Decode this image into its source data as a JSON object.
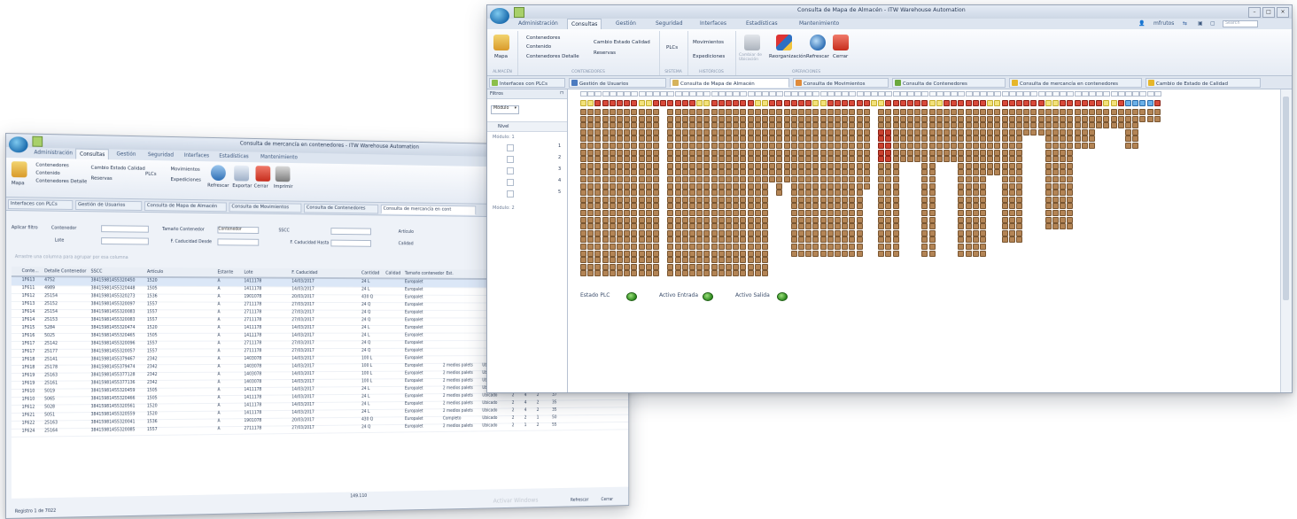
{
  "back_window": {
    "title": "Consulta de mercancía en contenedores - ITW Warehouse Automation",
    "menu_tabs": [
      "Administración",
      "Consultas",
      "Gestión",
      "Seguridad",
      "Interfaces",
      "Estadísticas",
      "Mantenimiento"
    ],
    "ribbon": {
      "mapa": "Mapa",
      "contenedores": "Contenedores",
      "contenido": "Contenido",
      "contenedores_detalle": "Contenedores Detalle",
      "cambio_estado": "Cambio Estado Calidad",
      "reservas": "Reservas",
      "plcs": "PLCs",
      "movimientos": "Movimientos",
      "expediciones": "Expediciones",
      "refrescar": "Refrescar",
      "exportar": "Exportar",
      "cerrar": "Cerrar",
      "imprimir": "Imprimir"
    },
    "doc_tabs": [
      "Interfaces con PLCs",
      "Gestión de Usuarios",
      "Consulta de Mapa de Almacén",
      "Consulta de Movimientos",
      "Consulta de Contenedores",
      "Consulta de mercancía en cont"
    ],
    "filters": {
      "aplicar": "Aplicar filtro",
      "contenedor": "Contenedor",
      "lote": "Lote",
      "tamano": "Tamaño Contenedor",
      "tamano_value": "Contenedor",
      "f_caducidad_desde": "F. Caducidad Desde",
      "sscc": "SSCC",
      "f_caducidad_hasta": "F. Caducidad Hasta",
      "articulo": "Artículo",
      "calidad": "Calidad"
    },
    "group_hint": "Arrastre una columna para agrupar por esa columna",
    "columns": [
      "Conte...",
      "Detalle Contenedor",
      "SSCC",
      "Artículo",
      "",
      "",
      "Estante",
      "Lote",
      "F. Caducidad",
      "Cantidad",
      "Calidad",
      "Tamaño contenedor",
      "Est."
    ],
    "rows": [
      [
        "1F613",
        "4752",
        "38415981455320450",
        "1520",
        "1411178",
        "14/03/2017",
        "24 L",
        "Europalet"
      ],
      [
        "1F611",
        "4989",
        "38415981455320448",
        "1505",
        "1411178",
        "14/03/2017",
        "24 L",
        "Europalet"
      ],
      [
        "1F612",
        "25154",
        "38415981455320273",
        "1536",
        "1901078",
        "20/03/2017",
        "430 Q",
        "Europalet"
      ],
      [
        "1F613",
        "25152",
        "38415981455320097",
        "1557",
        "2711178",
        "27/03/2017",
        "24 Q",
        "Europalet"
      ],
      [
        "1F614",
        "25154",
        "38415981455320083",
        "1557",
        "2711178",
        "27/03/2017",
        "24 Q",
        "Europalet"
      ],
      [
        "1F614",
        "25153",
        "38415981455320083",
        "1557",
        "2711178",
        "27/03/2017",
        "24 Q",
        "Europalet"
      ],
      [
        "1F615",
        "5284",
        "38415981455320474",
        "1520",
        "1411178",
        "14/03/2017",
        "24 L",
        "Europalet"
      ],
      [
        "1F616",
        "5025",
        "38415981455320465",
        "1505",
        "1411178",
        "14/03/2017",
        "24 L",
        "Europalet"
      ],
      [
        "1F617",
        "25142",
        "38415981455320096",
        "1557",
        "2711178",
        "27/03/2017",
        "24 Q",
        "Europalet"
      ],
      [
        "1F617",
        "25177",
        "38415981455320057",
        "1557",
        "2711178",
        "27/03/2017",
        "24 Q",
        "Europalet"
      ],
      [
        "1F618",
        "25141",
        "38415981455379467",
        "2342",
        "1403078",
        "14/03/2017",
        "100 L",
        "Europalet"
      ],
      [
        "1F618",
        "25178",
        "38415981455379474",
        "2342",
        "1403078",
        "14/03/2017",
        "100 L",
        "Europalet"
      ],
      [
        "1F619",
        "25163",
        "38415981455377128",
        "2342",
        "1403078",
        "14/03/2017",
        "100 L",
        "Europalet"
      ],
      [
        "1F619",
        "25161",
        "38415981455377136",
        "2342",
        "1403078",
        "14/03/2017",
        "100 L",
        "Europalet"
      ],
      [
        "1F610",
        "5019",
        "38415981455320459",
        "1505",
        "1411178",
        "14/03/2017",
        "24 L",
        "Europalet"
      ],
      [
        "1F610",
        "5065",
        "38415981455320466",
        "1505",
        "1411178",
        "14/03/2017",
        "24 L",
        "Europalet"
      ],
      [
        "1F612",
        "5028",
        "38415981455320561",
        "1520",
        "1411178",
        "14/03/2017",
        "24 L",
        "Europalet"
      ],
      [
        "1F621",
        "5051",
        "38415981455320559",
        "1520",
        "1411178",
        "14/03/2017",
        "24 L",
        "Europalet"
      ],
      [
        "1F622",
        "25163",
        "38415981455320041",
        "1536",
        "1901078",
        "20/03/2017",
        "430 Q",
        "Europalet"
      ],
      [
        "1F624",
        "25164",
        "38415981455320085",
        "1557",
        "2711178",
        "27/03/2017",
        "24 Q",
        "Europalet"
      ]
    ],
    "right_rows": [
      [
        "2 medios palets",
        "Ubicado",
        "2",
        "4",
        "2",
        "40"
      ],
      [
        "2 medios palets",
        "Ubicado",
        "2",
        "3",
        "2",
        "7"
      ],
      [
        "2 medios palets",
        "Ubicado",
        "1",
        "3",
        "2",
        "7"
      ],
      [
        "2 medios palets",
        "Ubicado",
        "2",
        "4",
        "2",
        "37"
      ],
      [
        "2 medios palets",
        "Ubicado",
        "2",
        "4",
        "2",
        "37"
      ],
      [
        "2 medios palets",
        "Ubicado",
        "2",
        "4",
        "2",
        "35"
      ],
      [
        "2 medios palets",
        "Ubicado",
        "2",
        "4",
        "2",
        "35"
      ],
      [
        "Completo",
        "Ubicado",
        "2",
        "2",
        "1",
        "50"
      ],
      [
        "2 medios palets",
        "Ubicado",
        "2",
        "1",
        "2",
        "55"
      ]
    ],
    "total": "149.110",
    "pager": "Registro 1 de 7022",
    "footer_refrescar": "Refrescar",
    "footer_cerrar": "Cerrar",
    "watermark": "Activar Windows"
  },
  "front_window": {
    "title": "Consulta de Mapa de Almacén - ITW Warehouse Automation",
    "menu_tabs": [
      "Administración",
      "Consultas",
      "Gestión",
      "Seguridad",
      "Interfaces",
      "Estadísticas",
      "Mantenimiento"
    ],
    "user": "mfrutos",
    "search_placeholder": "Search",
    "ribbon": {
      "mapa": "Mapa",
      "contenedores": "Contenedores",
      "contenido": "Contenido",
      "contenedores_detalle": "Contenedores Detalle",
      "cambio_estado": "Cambio Estado Calidad",
      "reservas": "Reservas",
      "plcs": "PLCs",
      "movimientos": "Movimientos",
      "expediciones": "Expediciones",
      "cambiar_ubicacion": "Cambiar de Ubicación",
      "reorganizacion": "Reorganización",
      "refrescar": "Refrescar",
      "cerrar": "Cerrar",
      "group_almacen": "ALMACÉN",
      "group_contenedores": "CONTENEDORES",
      "group_sistema": "SISTEMA",
      "group_historicos": "HISTÓRICOS",
      "group_operaciones": "OPERACIONES"
    },
    "doc_tabs": [
      {
        "label": "Interfaces con PLCs",
        "color": "#8cbf4a"
      },
      {
        "label": "Gestión de Usuarios",
        "color": "#4b7bc0"
      },
      {
        "label": "Consulta de Mapa de Almacén",
        "color": "#d6b35c"
      },
      {
        "label": "Consulta de Movimientos",
        "color": "#e08b3a"
      },
      {
        "label": "Consulta de Contenedores",
        "color": "#6aa83d"
      },
      {
        "label": "Consulta de mercancía en contenedores",
        "color": "#e6b62a"
      },
      {
        "label": "Cambio de Estado de Calidad",
        "color": "#e6b62a"
      }
    ],
    "left_panel": {
      "header": "Filtros",
      "modulo_select": "Módulo",
      "nivel_header": "Nivel",
      "modulo1": "Módulo: 1",
      "modulo2": "Módulo: 2",
      "levels": [
        "1",
        "2",
        "3",
        "4",
        "5"
      ]
    },
    "status": {
      "estado_plc": "Estado PLC",
      "activo_entrada": "Activo Entrada",
      "activo_salida": "Activo Salida"
    },
    "accent": "#c9412f",
    "crate_color": "#b38455"
  }
}
